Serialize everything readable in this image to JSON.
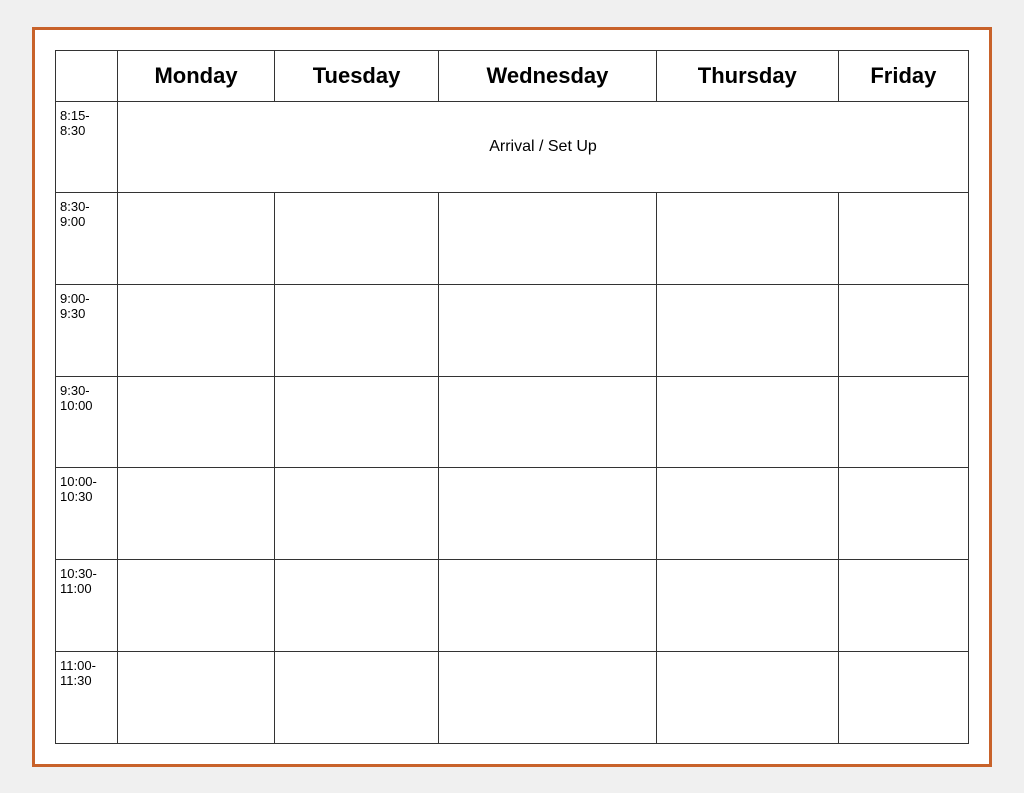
{
  "calendar": {
    "border_color": "#c8622a",
    "headers": {
      "time_col": "",
      "monday": "Monday",
      "tuesday": "Tuesday",
      "wednesday": "Wednesday",
      "thursday": "Thursday",
      "friday": "Friday"
    },
    "rows": [
      {
        "time": "8:15-\n8:30",
        "arrival_row": true,
        "arrival_text": "Arrival / Set Up"
      },
      {
        "time": "8:30-\n9:00",
        "arrival_row": false
      },
      {
        "time": "9:00-\n9:30",
        "arrival_row": false
      },
      {
        "time": "9:30-\n10:00",
        "arrival_row": false
      },
      {
        "time": "10:00-\n10:30",
        "arrival_row": false
      },
      {
        "time": "10:30-\n11:00",
        "arrival_row": false
      },
      {
        "time": "11:00-\n11:30",
        "arrival_row": false
      }
    ]
  }
}
